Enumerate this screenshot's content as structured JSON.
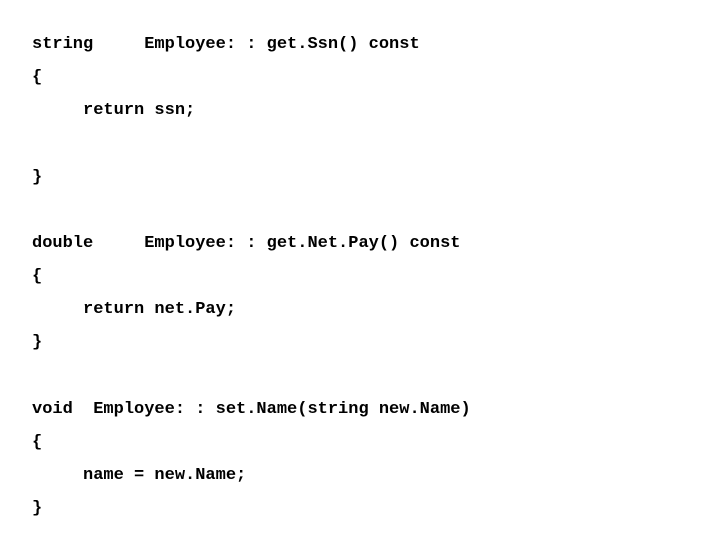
{
  "code": {
    "lines": [
      "string     Employee: : get.Ssn() const",
      "{",
      "     return ssn;",
      "",
      "}",
      "",
      "double     Employee: : get.Net.Pay() const",
      "{",
      "     return net.Pay;",
      "}",
      "",
      "void  Employee: : set.Name(string new.Name)",
      "{",
      "     name = new.Name;",
      "}"
    ]
  }
}
